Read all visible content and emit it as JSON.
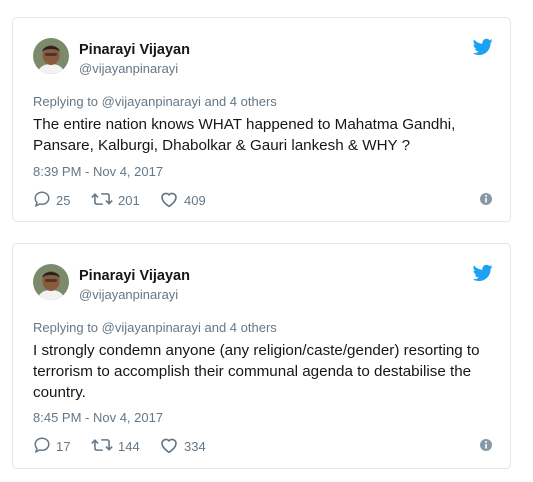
{
  "tweets": [
    {
      "name": "Pinarayi Vijayan",
      "handle": "@vijayanpinarayi",
      "reply_prefix": "Replying to",
      "reply_mention": "@vijayanpinarayi",
      "reply_suffix": "and 4 others",
      "text": "The entire nation knows WHAT happened to Mahatma Gandhi, Pansare, Kalburgi, Dhabolkar & Gauri lankesh & WHY ?",
      "timestamp": "8:39 PM - Nov 4, 2017",
      "replies": "25",
      "retweets": "201",
      "likes": "409"
    },
    {
      "name": "Pinarayi Vijayan",
      "handle": "@vijayanpinarayi",
      "reply_prefix": "Replying to",
      "reply_mention": "@vijayanpinarayi",
      "reply_suffix": "and 4 others",
      "text": "I strongly condemn anyone (any religion/caste/gender) resorting to terrorism to accomplish their communal agenda to destabilise the country.",
      "timestamp": "8:45 PM - Nov 4, 2017",
      "replies": "17",
      "retweets": "144",
      "likes": "334"
    }
  ],
  "colors": {
    "twitter_blue": "#1da1f2",
    "muted": "#657786",
    "border": "#e1e8ed"
  },
  "icons": [
    "twitter-bird-icon",
    "reply-icon",
    "retweet-icon",
    "heart-icon",
    "info-icon"
  ]
}
